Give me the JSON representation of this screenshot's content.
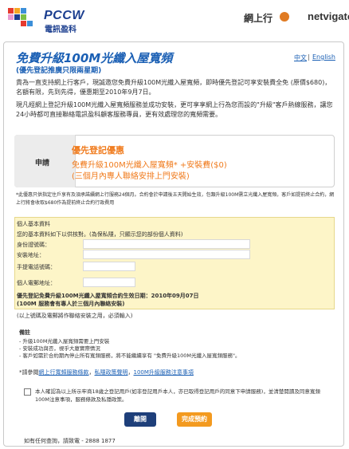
{
  "header": {
    "brand": "PCCW",
    "brand_sub": "電訊盈科",
    "partner_cn": "網上行",
    "partner_name": "netvigator"
  },
  "page": {
    "title": "免費升級100M光纖入屋寬頻",
    "subtitle": "(優先登記推廣只限兩星期)",
    "lang_zh": "中文",
    "lang_sep": "|",
    "lang_en": "English",
    "intro1": "貴為一直支持網上行客戶，現誠邀您免費升級100M光纖入屋寬頻，即時優先登記可享安裝費全免 (原價$680)，名額有限，先到先得，優惠期至2010年9月7日。",
    "intro2": "現凡經網上登記升級100M光纖入屋寬頻服務並成功安裝，更可享享網上行為您而設的\"升級\"客戶熱線服務，讓您24小時都可直接聯絡電訊盈科顧客服務專員，更有效處理您的寬頻需要。"
  },
  "offer": {
    "apply_label": "申請",
    "title": "優先登記優惠",
    "line2": "免費升級100M光纖入屋寬頻* +安裝費($0)",
    "line3": "(三個月內專人聯絡安排上門安裝)"
  },
  "footnote": "*此優惠只供指定住戶享有及須承諾續網上行服務24個月。合約會於申請後五天開始生效，包類升級100M需立光纖入屋寬頻，客戶如提前終止合約，網上行將會收取$680作為提前終止合約行政費用",
  "form": {
    "basic_info": "個人基本資料",
    "instruction": "您的基本資料如下以供核對。(為保私隱，只顯示您的部份個人資料)",
    "id_label": "身份證號碼：",
    "addr_label": "安裝地址：",
    "mobile_label": "手提電話號碼：",
    "email_label": "個人電郵地址：",
    "priority1": "優先登記免費升級100M光纖入屋寬頻合約生效日期：2010年09月07日",
    "priority2": "(100M 服務會有專人於三個月內聯絡安裝)",
    "required": "(以上號碼及電郵將作聯絡安裝之用，必須輸入)"
  },
  "notes": {
    "title": "備註",
    "n1": "- 升級100M光纖入屋寬頻需要上門安裝",
    "n2": "- 安裝成功與否，視乎大廈實際情況",
    "n3": "- 客戶如需於合約期內停止所有寬頻服務，將不能繼續享有 \"免費升級100M光纖入屋寬頻服務\"。"
  },
  "refer": {
    "prefix": "*請參閱",
    "link1": "網上行寬頻服務條款",
    "sep1": "，",
    "link2": "私隱政策聲明",
    "sep2": "，",
    "link3": "100M升級服務注意事項"
  },
  "agree": "本人確認為以上所示牢商18歲之登記用戶(如非登記用戶本人，亦已取得登記用戶的同意下申請服務)，並清楚閱讀及同意寬頻100M注意事項，服務條款及私隱政策。",
  "buttons": {
    "leave": "離開",
    "done": "完成預約"
  },
  "contact": "如有任何查詢，請致電 - 2888 1877",
  "colors": {
    "title_blue": "#1a5fb4",
    "offer_orange": "#f07b1d",
    "form_bg": "#fdf5c8",
    "btn_blue": "#1e3f7a",
    "btn_orange": "#f39a1f"
  }
}
